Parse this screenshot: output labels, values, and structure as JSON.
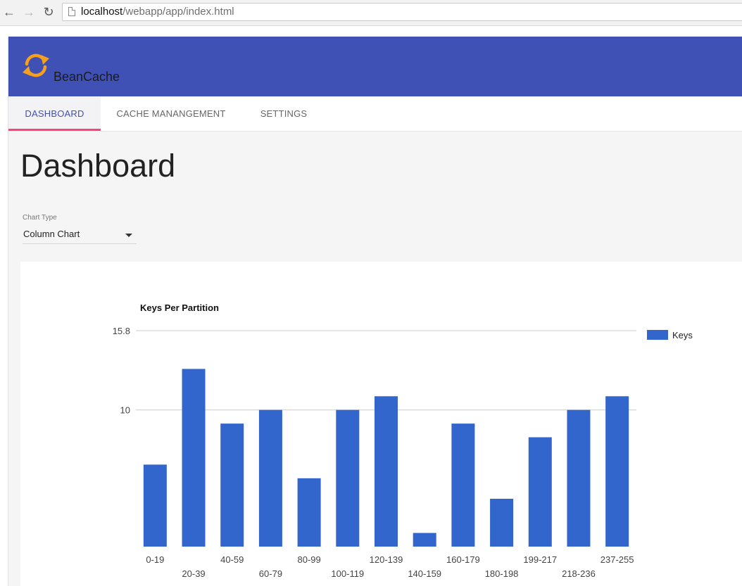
{
  "browser": {
    "back_icon": "back-arrow-icon",
    "forward_icon": "forward-arrow-icon",
    "reload_icon": "reload-icon",
    "url_host": "localhost",
    "url_path": "/webapp/app/index.html"
  },
  "app": {
    "title": "BeanCache",
    "logo_icon": "sync-arrows-icon",
    "brand_color": "#3f51b5",
    "accent_color": "#ff4081",
    "logo_color": "#f9a01b"
  },
  "tabs": [
    {
      "label": "Dashboard",
      "active": true
    },
    {
      "label": "Cache Manangement",
      "active": false
    },
    {
      "label": "Settings",
      "active": false
    }
  ],
  "page": {
    "title": "Dashboard"
  },
  "chart_type_select": {
    "label": "Chart Type",
    "value": "Column Chart"
  },
  "chart_data": {
    "type": "bar",
    "title": "Keys Per Partition",
    "categories": [
      "0-19",
      "20-39",
      "40-59",
      "60-79",
      "80-99",
      "100-119",
      "120-139",
      "140-159",
      "160-179",
      "180-198",
      "199-217",
      "218-236",
      "237-255"
    ],
    "series": [
      {
        "name": "Keys",
        "color": "#3366cc",
        "values": [
          6,
          13,
          9,
          10,
          5,
          10,
          11,
          1,
          9,
          3.5,
          8,
          10,
          11
        ]
      }
    ],
    "y_ticks": [
      {
        "value": 10,
        "label": "10"
      },
      {
        "value": 15.8,
        "label": "15.8"
      }
    ],
    "ylim": [
      0,
      15.8
    ],
    "grid": true,
    "legend_position": "right"
  }
}
